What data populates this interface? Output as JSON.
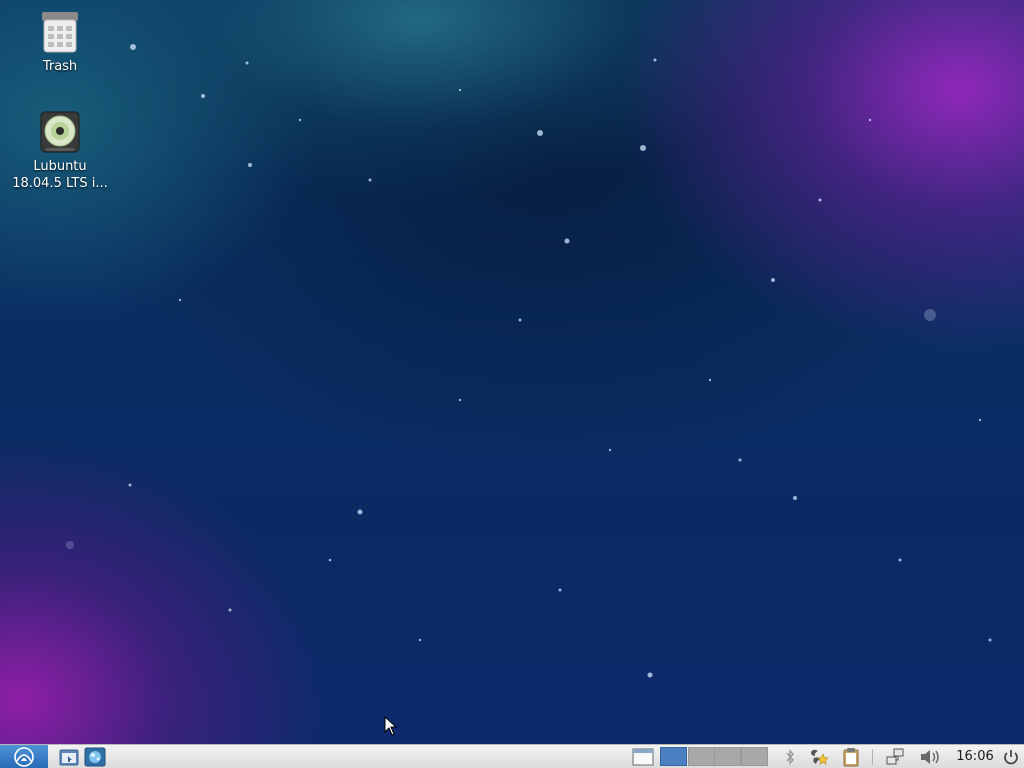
{
  "desktop": {
    "icons": [
      {
        "label_line1": "Trash",
        "label_line2": "",
        "icon": "trash-icon"
      },
      {
        "label_line1": "Lubuntu",
        "label_line2": "18.04.5 LTS i...",
        "icon": "optical-disc-icon"
      }
    ]
  },
  "taskbar": {
    "menu_icon": "lubuntu-menu-icon",
    "launchers": [
      {
        "icon": "file-manager-icon"
      },
      {
        "icon": "web-browser-icon"
      }
    ],
    "show_desktop_icon": "show-desktop-icon",
    "workspaces": {
      "count": 4,
      "active": 1
    },
    "tray": {
      "bluetooth_icon": "bluetooth-icon",
      "update_icon": "software-update-icon",
      "clipboard_icon": "clipboard-icon",
      "network_icon": "network-icon",
      "volume_icon": "volume-icon",
      "power_icon": "power-icon"
    },
    "clock": "16:06"
  },
  "colors": {
    "active_workspace": "#4a7fc1",
    "inactive_workspace": "#a8a8a8",
    "taskbar_bg": "#e6e6e6"
  }
}
